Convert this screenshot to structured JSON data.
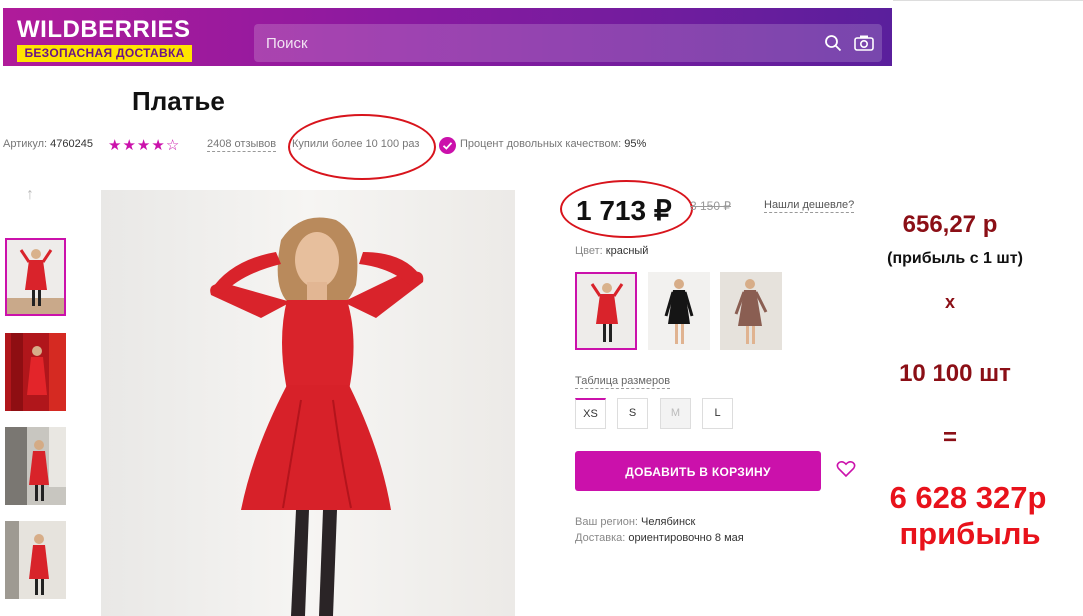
{
  "header": {
    "logo_text": "WILDBERRIES",
    "logo_tagline": "БЕЗОПАСНАЯ ДОСТАВКА",
    "search_placeholder": "Поиск"
  },
  "product": {
    "title": "Платье",
    "article_label": "Артикул:",
    "article_value": "4760245",
    "rating_stars": 4,
    "reviews": "2408 отзывов",
    "bought": "Купили более 10 100 раз",
    "quality_label": "Процент довольных качеством:",
    "quality_value": "95%",
    "price": "1 713 ₽",
    "old_price": "3 150 ₽",
    "cheaper_link": "Нашли дешевле?",
    "color_label": "Цвет:",
    "color_value": "красный",
    "size_table": "Таблица размеров",
    "sizes": [
      "XS",
      "S",
      "M",
      "L"
    ],
    "add_to_cart": "ДОБАВИТЬ В КОРЗИНУ",
    "region_label": "Ваш регион:",
    "region_value": "Челябинск",
    "delivery_label": "Доставка:",
    "delivery_value": "ориентировочно 8 мая"
  },
  "annotation": {
    "profit_per_unit": "656,27 р",
    "profit_note": "(прибыль с 1 шт)",
    "times": "х",
    "units": "10 100 шт",
    "equals": "=",
    "total": "6 628 327р",
    "total_label": "прибыль"
  },
  "colors": {
    "brand_magenta": "#cb11ab",
    "annotation_dark_red": "#8b0f16",
    "annotation_red": "#e8121b",
    "logo_yellow": "#ffe400"
  }
}
